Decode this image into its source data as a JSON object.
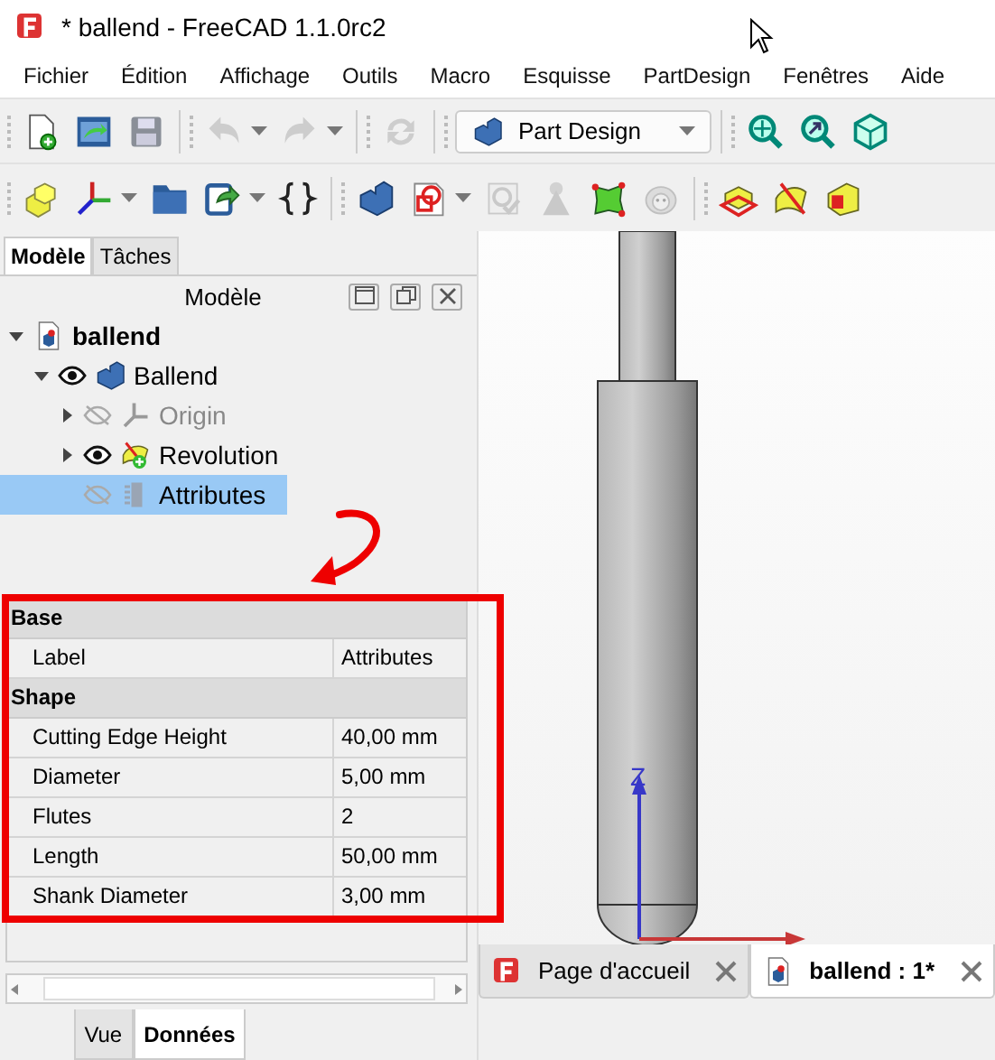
{
  "window": {
    "title": "* ballend - FreeCAD 1.1.0rc2"
  },
  "menu": [
    "Fichier",
    "Édition",
    "Affichage",
    "Outils",
    "Macro",
    "Esquisse",
    "PartDesign",
    "Fenêtres",
    "Aide"
  ],
  "toolbar_1": [
    {
      "kind": "new",
      "disabled": false
    },
    {
      "kind": "open",
      "disabled": false
    },
    {
      "kind": "save",
      "disabled": false
    },
    {
      "kind": "sep"
    },
    {
      "kind": "undo",
      "disabled": true,
      "caret": true
    },
    {
      "kind": "redo",
      "disabled": true,
      "caret": true
    },
    {
      "kind": "sep"
    },
    {
      "kind": "refresh",
      "disabled": true
    },
    {
      "kind": "sep"
    },
    {
      "kind": "workbench",
      "label": "Part Design"
    },
    {
      "kind": "sep"
    },
    {
      "kind": "zoom-fit",
      "disabled": false
    },
    {
      "kind": "zoom-select",
      "disabled": false
    },
    {
      "kind": "cube-view",
      "disabled": false
    }
  ],
  "toolbar_2": [
    {
      "kind": "part",
      "disabled": false
    },
    {
      "kind": "axes",
      "disabled": false,
      "caret": true
    },
    {
      "kind": "folder",
      "disabled": false
    },
    {
      "kind": "link",
      "disabled": false,
      "caret": true
    },
    {
      "kind": "braces",
      "disabled": false
    },
    {
      "kind": "sep"
    },
    {
      "kind": "body",
      "disabled": false
    },
    {
      "kind": "sketch",
      "disabled": false,
      "caret": true
    },
    {
      "kind": "validate",
      "disabled": true
    },
    {
      "kind": "cone",
      "disabled": true
    },
    {
      "kind": "patch",
      "disabled": false
    },
    {
      "kind": "sheep",
      "disabled": true
    },
    {
      "kind": "sep"
    },
    {
      "kind": "pad",
      "disabled": false
    },
    {
      "kind": "revolve",
      "disabled": false
    },
    {
      "kind": "pocket",
      "disabled": false
    }
  ],
  "panel_tabs": [
    {
      "label": "Modèle",
      "selected": true
    },
    {
      "label": "Tâches",
      "selected": false
    }
  ],
  "panel_title": "Modèle",
  "tree": [
    {
      "label": "ballend",
      "kind": "document",
      "expanded": true,
      "selected": false,
      "dimmed": false,
      "children": [
        {
          "label": "Ballend",
          "kind": "body",
          "visible": true,
          "expanded": true,
          "selected": false,
          "dimmed": false,
          "children": [
            {
              "label": "Origin",
              "kind": "origin",
              "visible": false,
              "expanded": false,
              "selected": false,
              "dimmed": true
            },
            {
              "label": "Revolution",
              "kind": "revolution",
              "visible": true,
              "expanded": false,
              "selected": false,
              "dimmed": false
            },
            {
              "label": "Attributes",
              "kind": "attributes",
              "visible": false,
              "selected": true,
              "dimmed": false
            }
          ]
        }
      ]
    }
  ],
  "properties": [
    {
      "group": "Base",
      "rows": [
        {
          "name": "Label",
          "value": "Attributes"
        }
      ]
    },
    {
      "group": "Shape",
      "rows": [
        {
          "name": "Cutting Edge Height",
          "value": "40,00 mm"
        },
        {
          "name": "Diameter",
          "value": "5,00 mm"
        },
        {
          "name": "Flutes",
          "value": "2"
        },
        {
          "name": "Length",
          "value": "50,00 mm"
        },
        {
          "name": "Shank Diameter",
          "value": "3,00 mm"
        }
      ]
    }
  ],
  "property_tabs": [
    {
      "label": "Vue",
      "selected": false
    },
    {
      "label": "Données",
      "selected": true
    }
  ],
  "view": {
    "axis_label": "Z"
  },
  "document_tabs": [
    {
      "label": "Page d'accueil",
      "kind": "start",
      "selected": false
    },
    {
      "label": "ballend : 1*",
      "kind": "document",
      "selected": true
    }
  ]
}
